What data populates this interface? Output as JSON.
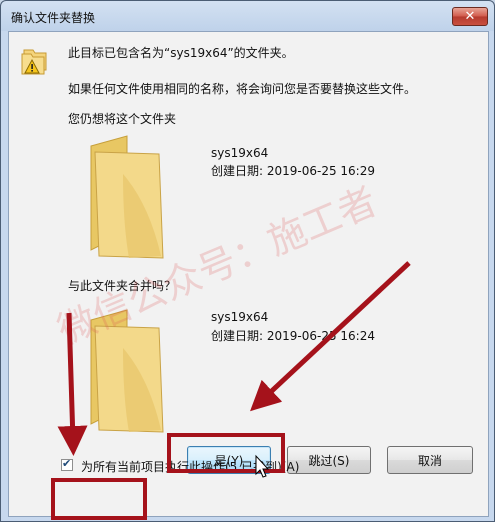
{
  "window": {
    "title": "确认文件夹替换"
  },
  "message": {
    "line1": "此目标已包含名为“sys19x64”的文件夹。",
    "line2": "如果任何文件使用相同的名称，将会询问您是否要替换这些文件。",
    "line3": "您仍想将这个文件夹",
    "merge_prompt": "与此文件夹合并吗？"
  },
  "source_folder": {
    "name": "sys19x64",
    "created": "创建日期: 2019-06-25 16:29"
  },
  "target_folder": {
    "name": "sys19x64",
    "created": "创建日期: 2019-06-25 16:24"
  },
  "buttons": {
    "yes": "是(Y)",
    "skip": "跳过(S)",
    "cancel": "取消"
  },
  "checkbox": {
    "label": "为所有当前项目执行此操作(5 已找到)(A)",
    "checked": true
  },
  "watermark": "微信公众号：施工者",
  "colors": {
    "annotation_red": "#a5121b"
  }
}
